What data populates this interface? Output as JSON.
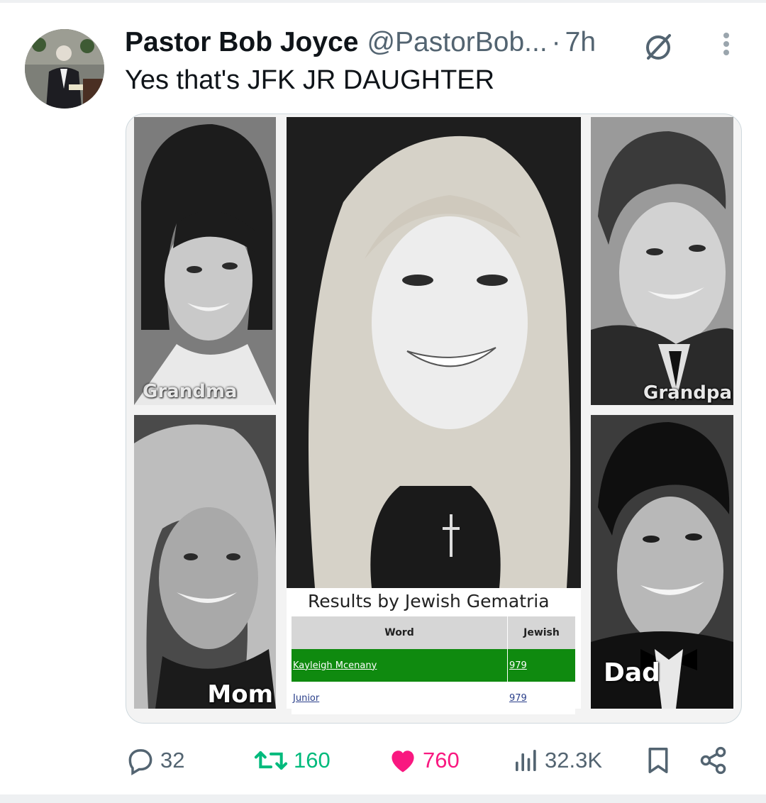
{
  "tweet": {
    "author_name": "Pastor Bob Joyce",
    "author_handle": "@PastorBob...",
    "separator": "·",
    "time": "7h",
    "text": "Yes that's JFK JR DAUGHTER"
  },
  "media": {
    "labels": {
      "grandma": "Grandma",
      "grandpa": "Grandpa",
      "mom": "Mom",
      "dad": "Dad"
    },
    "gematria": {
      "title": "Results by Jewish Gematria",
      "headers": {
        "word": "Word",
        "value": "Jewish"
      },
      "rows": [
        {
          "word": "Kayleigh Mcenany",
          "value": "979"
        },
        {
          "word": "Junior",
          "value": "979"
        }
      ]
    }
  },
  "actions": {
    "replies": "32",
    "reposts": "160",
    "likes": "760",
    "views": "32.3K"
  },
  "colors": {
    "repost": "#00ba7c",
    "like": "#f91880",
    "muted": "#536471",
    "highlight_row": "#0f8a0f"
  },
  "icons": [
    "grok-icon",
    "more-icon",
    "reply-icon",
    "repost-icon",
    "like-icon",
    "views-icon",
    "bookmark-icon",
    "share-icon"
  ]
}
